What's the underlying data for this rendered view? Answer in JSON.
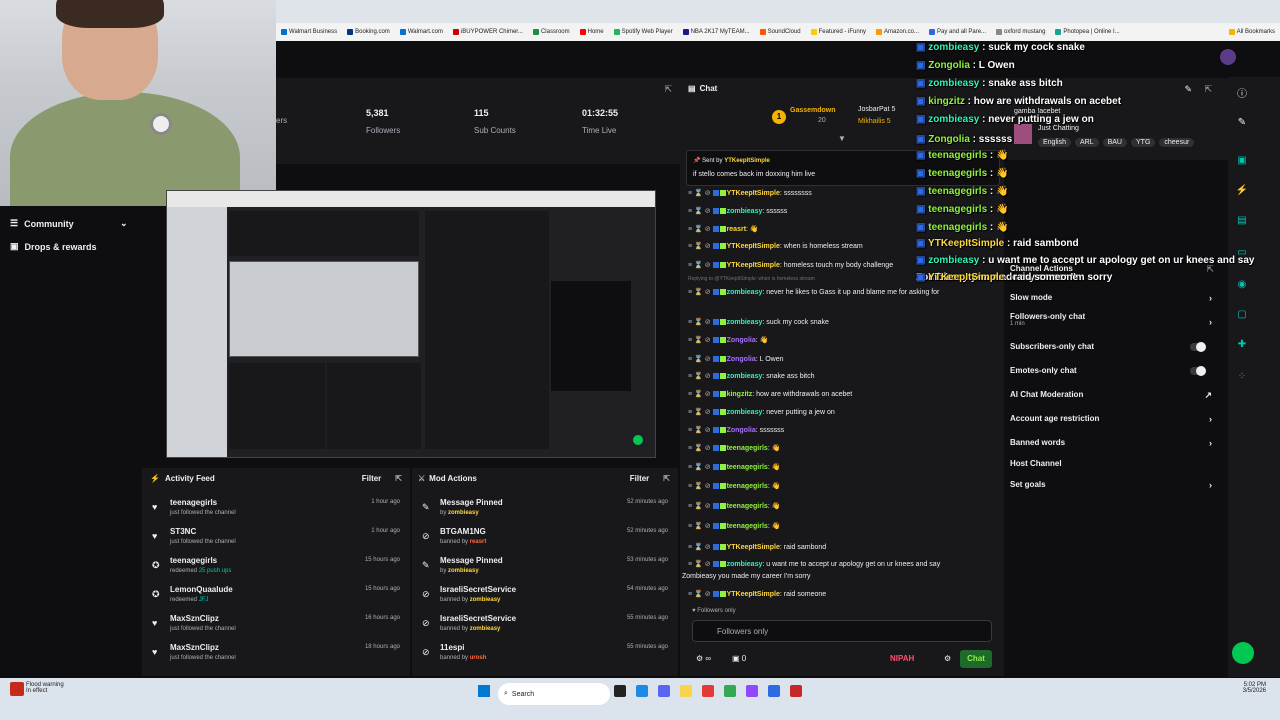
{
  "browser": {
    "bookmarks": [
      "Walmart Business",
      "Booking.com",
      "Walmart.com",
      "iBUYPOWER Chimer...",
      "Classroom",
      "Home",
      "Spotify Web Player",
      "NBA 2K17 MyTEAM...",
      "SoundCloud",
      "Featured - iFunny",
      "Amazon.co...",
      "Pay and all Pare...",
      "oxford mustang",
      "Photopea | Online I...",
      "All Bookmarks"
    ]
  },
  "stats": [
    {
      "value": "",
      "label": "ers"
    },
    {
      "value": "5,381",
      "label": "Followers"
    },
    {
      "value": "115",
      "label": "Sub Counts"
    },
    {
      "value": "01:32:55",
      "label": "Time Live"
    }
  ],
  "sidebar": {
    "items": [
      {
        "label": "Community",
        "icon": "community-icon"
      },
      {
        "label": "Drops & rewards",
        "icon": "gift-icon"
      }
    ]
  },
  "activity_feed": {
    "title": "Activity Feed",
    "filter_label": "Filter",
    "items": [
      {
        "name": "teenagegirls",
        "sub": "just followed the channel",
        "highlight": "",
        "time": "1 hour ago",
        "icon": "heart-icon"
      },
      {
        "name": "ST3NC",
        "sub": "just followed the channel",
        "highlight": "",
        "time": "1 hour ago",
        "icon": "heart-icon"
      },
      {
        "name": "teenagegirls",
        "sub": "redeemed",
        "highlight": "25 push ups",
        "time": "15 hours ago",
        "icon": "points-icon"
      },
      {
        "name": "LemonQuaalude",
        "sub": "redeemed",
        "highlight": "JFJ",
        "time": "15 hours ago",
        "icon": "points-icon"
      },
      {
        "name": "MaxSznClipz",
        "sub": "just followed the channel",
        "highlight": "",
        "time": "16 hours ago",
        "icon": "heart-icon"
      },
      {
        "name": "MaxSznClipz",
        "sub": "just followed the channel",
        "highlight": "",
        "time": "18 hours ago",
        "icon": "heart-icon"
      }
    ]
  },
  "mod_actions": {
    "title": "Mod Actions",
    "filter_label": "Filter",
    "items": [
      {
        "name": "Message Pinned",
        "by": "by",
        "mod": "zombieasy",
        "time": "52 minutes ago",
        "icon": "pin-icon"
      },
      {
        "name": "BTGAM1NG",
        "by": "banned by",
        "mod": "reasrt",
        "time": "52 minutes ago",
        "icon": "ban-icon"
      },
      {
        "name": "Message Pinned",
        "by": "by",
        "mod": "zombieasy",
        "time": "53 minutes ago",
        "icon": "pin-icon"
      },
      {
        "name": "IsraeliSecretService",
        "by": "banned by",
        "mod": "zombieasy",
        "time": "54 minutes ago",
        "icon": "ban-icon"
      },
      {
        "name": "IsraeliSecretService",
        "by": "banned by",
        "mod": "zombieasy",
        "time": "55 minutes ago",
        "icon": "ban-icon"
      },
      {
        "name": "11espi",
        "by": "banned by",
        "mod": "urosh",
        "time": "55 minutes ago",
        "icon": "ban-icon"
      }
    ]
  },
  "chat": {
    "title": "Chat",
    "gifter_rank": "1",
    "gifter_name": "Gassemdown",
    "gifter_count": "20",
    "gifters": [
      {
        "name": "JosbarPat",
        "count": "5"
      },
      {
        "name": "Mikhailis",
        "count": "5"
      }
    ],
    "pinned_by_label": "Sent by",
    "pinned_user": "YTKeepItSimple",
    "pinned_message": "if stello comes back im doxxing him live",
    "reply_context": "Replying to @YTKeepItSimple: when is homeless stream",
    "messages": [
      {
        "user": "YTKeepItSimple",
        "text": "ssssssss",
        "color": "#ffd83b"
      },
      {
        "user": "zombieasy",
        "text": "ssssss",
        "color": "#2ef5b8"
      },
      {
        "user": "reasrt",
        "text": "",
        "color": "#ffd83b"
      },
      {
        "user": "YTKeepItSimple",
        "text": "when is homeless stream",
        "color": "#ffd83b"
      },
      {
        "user": "YTKeepItSimple",
        "text": "homeless touch my body challenge",
        "color": "#ffd83b"
      },
      {
        "user": "zombieasy",
        "text": "never he likes to Gass it up and blame me for asking for",
        "color": "#2ef5b8"
      },
      {
        "user": "zombieasy",
        "text": "suck my cock snake",
        "color": "#2ef5b8"
      },
      {
        "user": "Zongolia",
        "text": "",
        "color": "#a970ff"
      },
      {
        "user": "Zongolia",
        "text": "L Owen",
        "color": "#a970ff"
      },
      {
        "user": "zombieasy",
        "text": "snake ass bitch",
        "color": "#2ef5b8"
      },
      {
        "user": "kingzitz",
        "text": "how are withdrawals on acebet",
        "color": "#8ef33b"
      },
      {
        "user": "zombieasy",
        "text": "never putting a jew on",
        "color": "#2ef5b8"
      },
      {
        "user": "Zongolia",
        "text": "sssssss",
        "color": "#a970ff"
      },
      {
        "user": "teenagegirls",
        "text": "",
        "color": "#8ef33b"
      },
      {
        "user": "teenagegirls",
        "text": "",
        "color": "#8ef33b"
      },
      {
        "user": "teenagegirls",
        "text": "",
        "color": "#8ef33b"
      },
      {
        "user": "teenagegirls",
        "text": "",
        "color": "#8ef33b"
      },
      {
        "user": "teenagegirls",
        "text": "",
        "color": "#8ef33b"
      },
      {
        "user": "YTKeepItSimple",
        "text": "raid sambond",
        "color": "#ffd83b"
      },
      {
        "user": "zombieasy",
        "text": "u want me to accept ur apology get on ur knees and say",
        "color": "#2ef5b8"
      },
      {
        "user": "",
        "text": "Zombieasy you made my career I'm sorry",
        "color": "#efeff1"
      },
      {
        "user": "YTKeepItSimple",
        "text": "raid someone",
        "color": "#ffd83b"
      }
    ],
    "followers_only_note": "Followers only",
    "input_placeholder": "Followers only",
    "points": "0",
    "bits_label": "NIPAH",
    "send_label": "Chat"
  },
  "channel_actions": {
    "title": "Channel Actions",
    "stream_title": "gamba !acebet",
    "category": "Just Chatting",
    "tags": [
      "English",
      "ARL",
      "BAU",
      "YTG",
      "cheesur"
    ],
    "items": [
      {
        "label": "Slow mode",
        "sub": "",
        "control": "chevron"
      },
      {
        "label": "Followers-only chat",
        "sub": "1 min",
        "control": "chevron"
      },
      {
        "label": "Subscribers-only chat",
        "sub": "",
        "control": "toggle"
      },
      {
        "label": "Emotes-only chat",
        "sub": "",
        "control": "toggle"
      },
      {
        "label": "AI Chat Moderation",
        "sub": "",
        "control": "external"
      },
      {
        "label": "Account age restriction",
        "sub": "",
        "control": "chevron"
      },
      {
        "label": "Banned words",
        "sub": "",
        "control": "chevron"
      },
      {
        "label": "Host Channel",
        "sub": "",
        "control": "none"
      },
      {
        "label": "Set goals",
        "sub": "",
        "control": "chevron"
      }
    ]
  },
  "overlay": {
    "lines": [
      {
        "user": "zombieasy",
        "text": "suck my cock snake"
      },
      {
        "user": "Zongolia",
        "text": "L Owen"
      },
      {
        "user": "zombieasy",
        "text": "snake ass bitch"
      },
      {
        "user": "kingzitz",
        "text": "how are withdrawals on acebet"
      },
      {
        "user": "zombieasy",
        "text": "never putting a jew on"
      },
      {
        "user": "Zongolia",
        "text": "ssssss"
      },
      {
        "user": "teenagegirls",
        "text": ""
      },
      {
        "user": "teenagegirls",
        "text": ""
      },
      {
        "user": "teenagegirls",
        "text": ""
      },
      {
        "user": "teenagegirls",
        "text": ""
      },
      {
        "user": "teenagegirls",
        "text": ""
      },
      {
        "user": "YTKeepItSimple",
        "text": "raid sambond"
      },
      {
        "user": "zombieasy",
        "text": "u want me to accept ur apology get on ur knees and say"
      },
      {
        "user": "",
        "text": "Zombieasy you made my career I'm sorry"
      },
      {
        "user": "YTKeepItSimple",
        "text": "raid someone"
      }
    ]
  },
  "taskbar": {
    "weather_title": "Flood warning",
    "weather_sub": "In effect",
    "search_placeholder": "Search",
    "time": "5:02 PM",
    "date": "3/5/2026"
  },
  "colors": {
    "accent": "#9147ff",
    "green": "#00c8af",
    "bg": "#0e0e10",
    "panel": "#18181b"
  }
}
